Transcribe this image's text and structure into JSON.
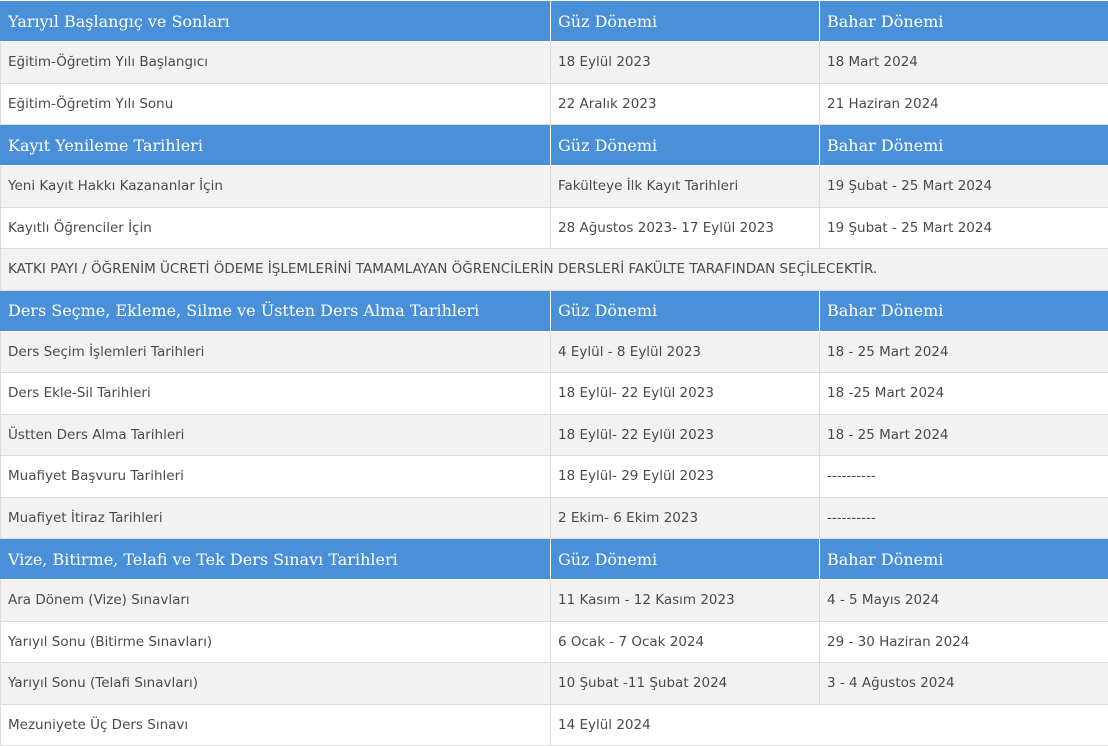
{
  "sections": [
    {
      "header": [
        "Yarıyıl Başlangıç ve Sonları",
        "Güz Dönemi",
        "Bahar Dönemi"
      ],
      "rows": [
        [
          "Eğitim-Öğretim Yılı Başlangıcı",
          "18 Eylül 2023",
          "18 Mart 2024"
        ],
        [
          "Eğitim-Öğretim Yılı Sonu",
          "22 Aralık 2023",
          "21 Haziran 2024"
        ]
      ]
    },
    {
      "header": [
        "Kayıt Yenileme Tarihleri",
        "Güz Dönemi",
        "Bahar Dönemi"
      ],
      "rows": [
        [
          "Yeni Kayıt Hakkı Kazananlar İçin",
          "Fakülteye İlk Kayıt Tarihleri",
          "19 Şubat - 25 Mart 2024"
        ],
        [
          "Kayıtlı Öğrenciler İçin",
          "28 Ağustos 2023- 17 Eylül 2023",
          "19 Şubat - 25 Mart 2024"
        ]
      ],
      "notice": "KATKI PAYI / ÖĞRENİM ÜCRETİ ÖDEME İŞLEMLERİNİ TAMAMLAYAN ÖĞRENCİLERİN DERSLERİ FAKÜLTE TARAFINDAN SEÇİLECEKTİR."
    },
    {
      "header": [
        "Ders Seçme, Ekleme, Silme ve Üstten Ders Alma Tarihleri",
        "Güz Dönemi",
        "Bahar Dönemi"
      ],
      "rows": [
        [
          "Ders Seçim İşlemleri Tarihleri",
          "4 Eylül - 8 Eylül 2023",
          "18 - 25 Mart 2024"
        ],
        [
          "Ders Ekle-Sil Tarihleri",
          "18 Eylül- 22 Eylül 2023",
          "18 -25 Mart 2024"
        ],
        [
          "Üstten Ders Alma Tarihleri",
          "18 Eylül- 22 Eylül 2023",
          "18 - 25 Mart 2024"
        ],
        [
          "Muafiyet Başvuru Tarihleri",
          "18 Eylül- 29 Eylül 2023",
          "----------"
        ],
        [
          "Muafiyet İtiraz Tarihleri",
          "2 Ekim- 6 Ekim 2023",
          "----------"
        ]
      ]
    },
    {
      "header": [
        "Vize, Bitirme, Telafi ve Tek Ders Sınavı Tarihleri",
        "Güz Dönemi",
        "Bahar Dönemi"
      ],
      "rows": [
        [
          "Ara Dönem (Vize) Sınavları",
          "11 Kasım - 12 Kasım 2023",
          "4 - 5 Mayıs 2024"
        ],
        [
          "Yarıyıl Sonu (Bitirme Sınavları)",
          "6 Ocak - 7 Ocak 2024",
          "29 - 30 Haziran 2024"
        ],
        [
          "Yarıyıl Sonu (Telafi Sınavları)",
          "10 Şubat -11 Şubat 2024",
          "3 - 4 Ağustos 2024"
        ]
      ],
      "merged_row": [
        "Mezuniyete Üç Ders Sınavı",
        "14 Eylül 2024"
      ]
    }
  ]
}
